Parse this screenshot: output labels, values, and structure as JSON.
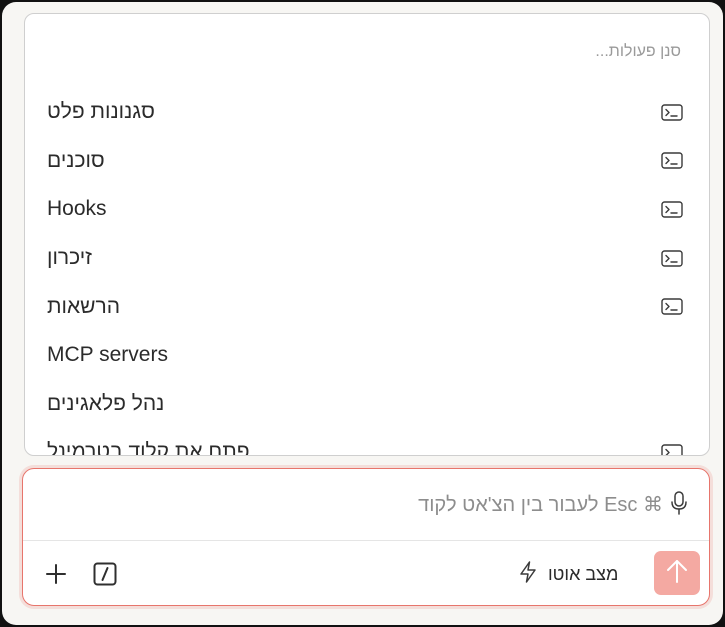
{
  "menu": {
    "search_placeholder": "סנן פעולות...",
    "items": [
      {
        "label": "סגנונות פלט",
        "icon": "terminal-icon",
        "has_icon": true
      },
      {
        "label": "סוכנים",
        "icon": "terminal-icon",
        "has_icon": true
      },
      {
        "label": "Hooks",
        "icon": "terminal-icon",
        "has_icon": true
      },
      {
        "label": "זיכרון",
        "icon": "terminal-icon",
        "has_icon": true
      },
      {
        "label": "הרשאות",
        "icon": "terminal-icon",
        "has_icon": true
      },
      {
        "label": "MCP servers",
        "icon": "",
        "has_icon": false
      },
      {
        "label": "נהל פלאגינים",
        "icon": "",
        "has_icon": false
      },
      {
        "label": "פתח את קלוד בטרמינל",
        "icon": "terminal-icon",
        "has_icon": true
      }
    ]
  },
  "composer": {
    "placeholder": "⌘ Esc לעבור בין הצ'אט לקוד",
    "mode_label": "מצב אוטו",
    "mode_icon": "lightning-icon",
    "mic_icon": "microphone-icon",
    "add_icon": "plus-icon",
    "slash_icon": "slash-command-icon",
    "send_icon": "arrow-up-icon"
  },
  "colors": {
    "accent_border": "#e7756c",
    "send_button": "#f4a9a2",
    "background": "#f7f6f3"
  }
}
